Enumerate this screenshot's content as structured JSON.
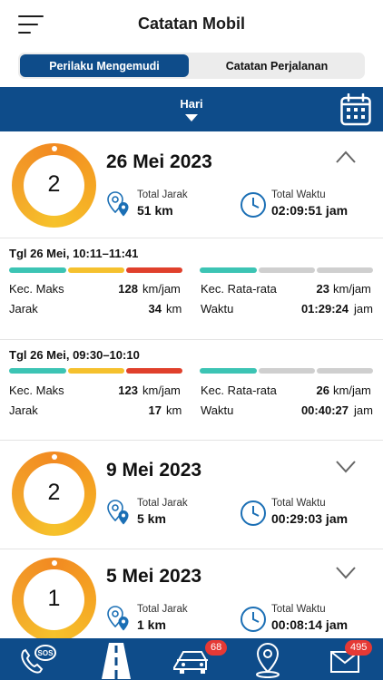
{
  "header": {
    "title": "Catatan Mobil"
  },
  "tabs": [
    {
      "label": "Perilaku Mengemudi",
      "active": true
    },
    {
      "label": "Catatan Perjalanan",
      "active": false
    }
  ],
  "filter": {
    "period": "Hari"
  },
  "days": [
    {
      "score": "2",
      "date": "26 Mei 2023",
      "expanded": true,
      "distance_label": "Total Jarak",
      "distance": "51 km",
      "time_label": "Total Waktu",
      "time": "02:09:51 jam",
      "trips": [
        {
          "title": "Tgl 26 Mei, 10:11–11:41",
          "max_speed_label": "Kec. Maks",
          "max_speed": "128",
          "max_speed_unit": "km/jam",
          "distance_label": "Jarak",
          "distance": "34",
          "distance_unit": "km",
          "avg_speed_label": "Kec. Rata-rata",
          "avg_speed": "23",
          "avg_speed_unit": "km/jam",
          "duration_label": "Waktu",
          "duration": "01:29:24",
          "duration_unit": "jam"
        },
        {
          "title": "Tgl 26 Mei, 09:30–10:10",
          "max_speed_label": "Kec. Maks",
          "max_speed": "123",
          "max_speed_unit": "km/jam",
          "distance_label": "Jarak",
          "distance": "17",
          "distance_unit": "km",
          "avg_speed_label": "Kec. Rata-rata",
          "avg_speed": "26",
          "avg_speed_unit": "km/jam",
          "duration_label": "Waktu",
          "duration": "00:40:27",
          "duration_unit": "jam"
        }
      ]
    },
    {
      "score": "2",
      "date": "9 Mei 2023",
      "expanded": false,
      "distance_label": "Total Jarak",
      "distance": "5 km",
      "time_label": "Total Waktu",
      "time": "00:29:03 jam"
    },
    {
      "score": "1",
      "date": "5 Mei 2023",
      "expanded": false,
      "distance_label": "Total Jarak",
      "distance": "1 km",
      "time_label": "Total Waktu",
      "time": "00:08:14 jam"
    }
  ],
  "bottom_nav": {
    "items": [
      {
        "icon": "sos-phone-icon"
      },
      {
        "icon": "road-icon"
      },
      {
        "icon": "car-icon",
        "badge": "68"
      },
      {
        "icon": "location-pin-icon"
      },
      {
        "icon": "mail-icon",
        "badge": "495"
      }
    ]
  },
  "colors": {
    "primary": "#0e4c8a",
    "ring_orange": "#f28a21",
    "ring_yellow": "#f6c22b",
    "bar_teal": "#3cc4b4",
    "bar_yellow": "#f5c12e",
    "bar_red": "#e0402c",
    "bar_grey": "#cfcfcf",
    "badge_red": "#e53935"
  }
}
